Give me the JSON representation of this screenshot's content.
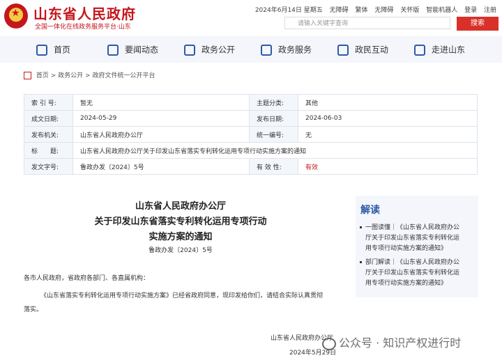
{
  "header": {
    "title": "山东省人民政府",
    "subtitle": "全国一体化在线政务服务平台·山东",
    "date": "2024年6月14日 星期五",
    "links": [
      "无障碍",
      "繁体",
      "无障碍",
      "关怀版",
      "智能机器人",
      "登录",
      "注册"
    ],
    "search_placeholder": "请输入关键字查询",
    "search_label": "搜索"
  },
  "nav": [
    "首页",
    "要闻动态",
    "政务公开",
    "政务服务",
    "政民互动",
    "走进山东"
  ],
  "breadcrumb": [
    "首页",
    "政务公开",
    "政府文件统一公开平台"
  ],
  "meta": {
    "index_label": "索 引 号:",
    "index_value": "暂无",
    "category_label": "主题分类:",
    "category_value": "其他",
    "created_label": "成文日期:",
    "created_value": "2024-05-29",
    "published_label": "发布日期:",
    "published_value": "2024-06-03",
    "issuer_label": "发布机关:",
    "issuer_value": "山东省人民政府办公厅",
    "unified_label": "统一编号:",
    "unified_value": "无",
    "title_label": "标　　题:",
    "title_value": "山东省人民政府办公厅关于印发山东省落实专利转化运用专项行动实施方案的通知",
    "docno_label": "发文字号:",
    "docno_value": "鲁政办发〔2024〕5号",
    "validity_label": "有 效 性:",
    "validity_value": "有效"
  },
  "article": {
    "title_lines": [
      "山东省人民政府办公厅",
      "关于印发山东省落实专利转化运用专项行动",
      "实施方案的通知"
    ],
    "doc_no": "鲁政办发〔2024〕5号",
    "recipients": "各市人民政府，省政府各部门、各直属机构：",
    "body_line1": "《山东省落实专利转化运用专项行动实施方案》已经省政府同意，现印发给你们，请结合实际认真贯彻",
    "body_line2": "落实。",
    "signature": "山东省人民政府办公厅",
    "date": "2024年5月29日"
  },
  "sidebar": {
    "title": "解读",
    "items": [
      [
        "一图读懂｜《山东省人民政府办公",
        "厅关于印发山东省落实专利转化运",
        "用专项行动实施方案的通知》"
      ],
      [
        "部门解读｜《山东省人民政府办公",
        "厅关于印发山东省落实专利转化运",
        "用专项行动实施方案的通知》"
      ]
    ]
  },
  "watermark": "公众号 · 知识产权进行时"
}
